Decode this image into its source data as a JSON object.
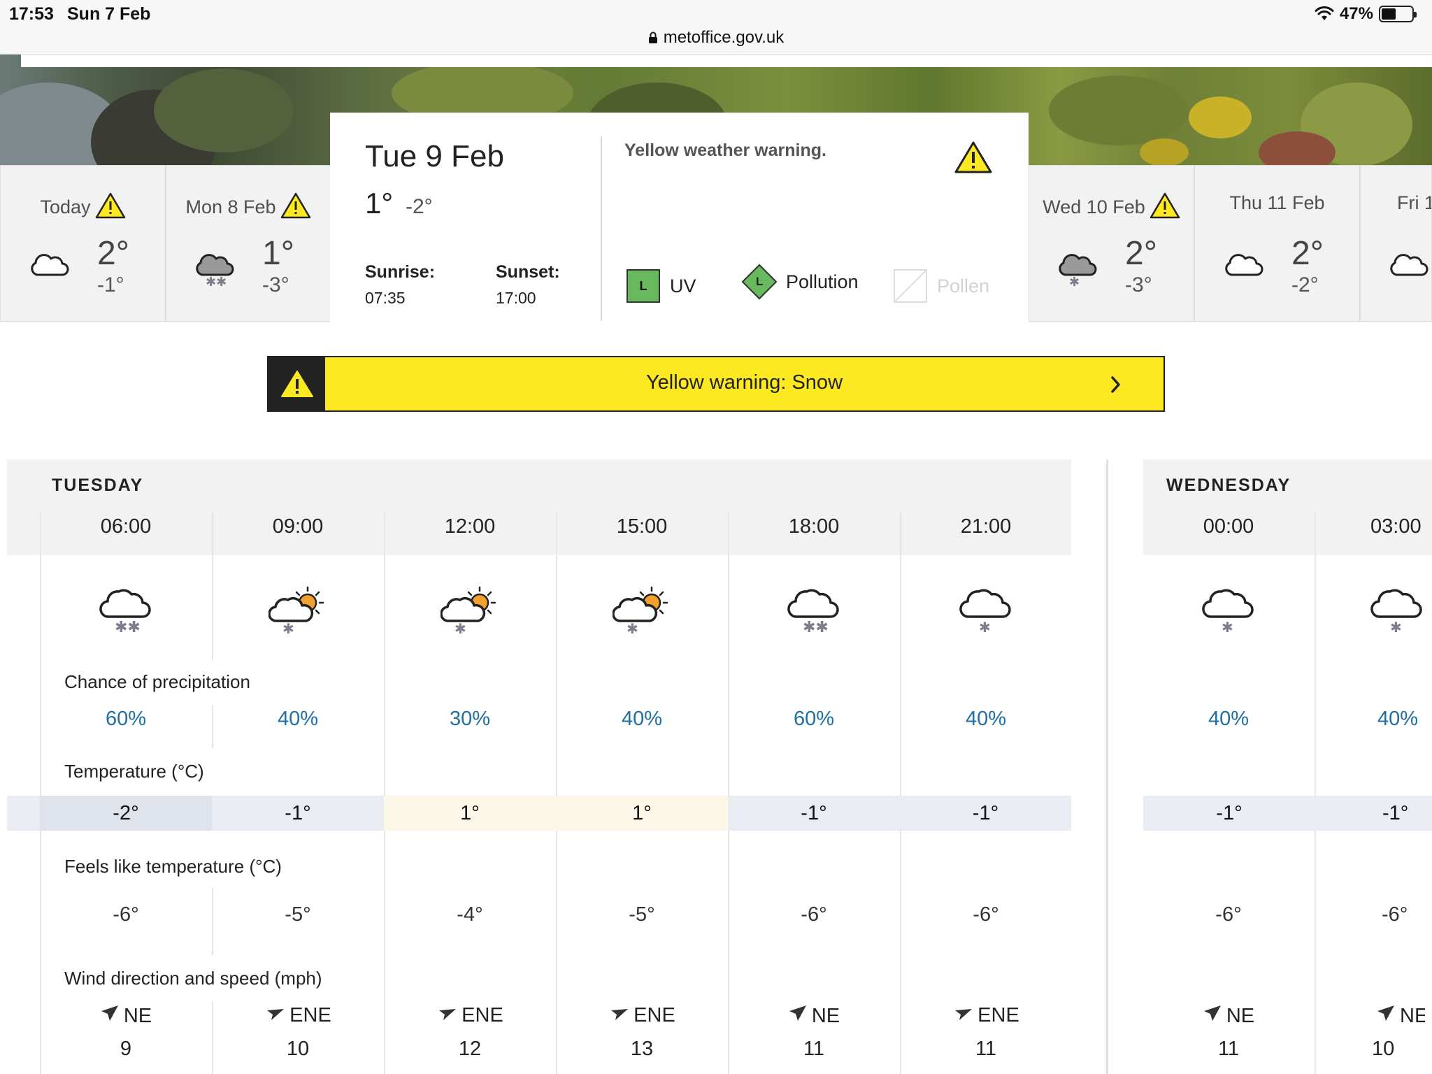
{
  "status_bar": {
    "time": "17:53",
    "date": "Sun 7 Feb",
    "battery": "47%",
    "battery_level": 0.47
  },
  "browser": {
    "url": "metoffice.gov.uk"
  },
  "days": [
    {
      "label": "Today",
      "warning": true,
      "high": "2°",
      "low": "-1°",
      "icon": "cloud-icon"
    },
    {
      "label": "Mon 8 Feb",
      "warning": true,
      "high": "1°",
      "low": "-3°",
      "icon": "heavy-snow-cloud-icon"
    },
    {
      "label": "Wed 10 Feb",
      "warning": true,
      "high": "2°",
      "low": "-3°",
      "icon": "light-snow-cloud-icon"
    },
    {
      "label": "Thu 11 Feb",
      "warning": false,
      "high": "2°",
      "low": "-2°",
      "icon": "cloud-icon"
    },
    {
      "label": "Fri 1",
      "warning": false,
      "high": "",
      "low": "",
      "icon": "cloud-icon"
    }
  ],
  "selected_day": {
    "date": "Tue 9 Feb",
    "high": "1°",
    "low": "-2°",
    "sunrise_label": "Sunrise:",
    "sunrise": "07:35",
    "sunset_label": "Sunset:",
    "sunset": "17:00",
    "warning_title": "Yellow weather warning.",
    "uv_level": "L",
    "uv_label": "UV",
    "pollution_level": "L",
    "pollution_label": "Pollution",
    "pollen_label": "Pollen"
  },
  "banner": {
    "text": "Yellow warning: Snow"
  },
  "forecast": {
    "day1_label": "TUESDAY",
    "day2_label": "WEDNESDAY",
    "labels": {
      "precip": "Chance of precipitation",
      "temp": "Temperature (°C)",
      "feels": "Feels like temperature (°C)",
      "wind": "Wind direction and speed (mph)"
    },
    "columns": [
      {
        "time": "06:00",
        "icon": "heavy-snow-cloud-icon",
        "precip": "60%",
        "temp": "-2°",
        "feels": "-6°",
        "wind_dir": "NE",
        "wind_speed": "9"
      },
      {
        "time": "09:00",
        "icon": "sun-snow-cloud-icon",
        "precip": "40%",
        "temp": "-1°",
        "feels": "-5°",
        "wind_dir": "ENE",
        "wind_speed": "10"
      },
      {
        "time": "12:00",
        "icon": "sun-snow-cloud-icon",
        "precip": "30%",
        "temp": "1°",
        "feels": "-4°",
        "wind_dir": "ENE",
        "wind_speed": "12"
      },
      {
        "time": "15:00",
        "icon": "sun-snow-cloud-icon",
        "precip": "40%",
        "temp": "1°",
        "feels": "-5°",
        "wind_dir": "ENE",
        "wind_speed": "13"
      },
      {
        "time": "18:00",
        "icon": "heavy-snow-cloud-icon",
        "precip": "60%",
        "temp": "-1°",
        "feels": "-6°",
        "wind_dir": "NE",
        "wind_speed": "11"
      },
      {
        "time": "21:00",
        "icon": "light-snow-cloud-icon",
        "precip": "40%",
        "temp": "-1°",
        "feels": "-6°",
        "wind_dir": "ENE",
        "wind_speed": "11"
      },
      {
        "time": "00:00",
        "icon": "light-snow-cloud-icon",
        "precip": "40%",
        "temp": "-1°",
        "feels": "-6°",
        "wind_dir": "NE",
        "wind_speed": "11"
      },
      {
        "time": "03:00",
        "icon": "light-snow-cloud-icon",
        "precip": "40%",
        "temp": "-1°",
        "feels": "-6°",
        "wind_dir": "NE",
        "wind_speed": "10"
      }
    ]
  },
  "colors": {
    "warning_yellow": "#fce922",
    "precip_blue": "#1f6fa3",
    "index_green": "#68b85e"
  }
}
